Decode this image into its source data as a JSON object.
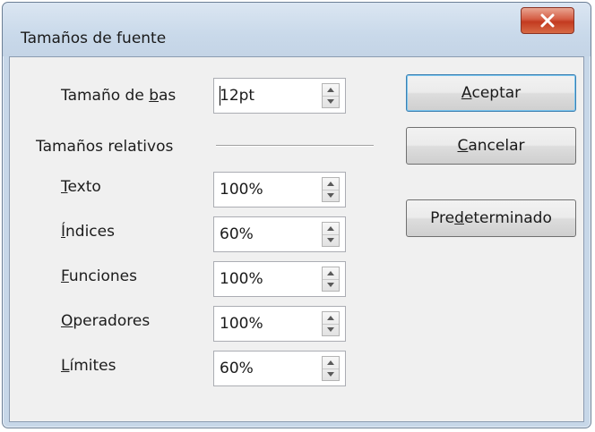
{
  "window": {
    "title": "Tamaños de fuente"
  },
  "base_size": {
    "label_pre": "Tamaño de ",
    "label_mnemonic": "b",
    "label_post": "as",
    "value": "12pt"
  },
  "relative": {
    "heading": "Tamaños relativos",
    "rows": [
      {
        "mnemonic": "T",
        "rest": "exto",
        "value": "100%"
      },
      {
        "mnemonic": "Í",
        "rest": "ndices",
        "value": "60%"
      },
      {
        "mnemonic": "F",
        "rest": "unciones",
        "value": "100%"
      },
      {
        "mnemonic": "O",
        "rest": "peradores",
        "value": "100%"
      },
      {
        "mnemonic": "L",
        "rest": "ímites",
        "value": "60%"
      }
    ]
  },
  "buttons": {
    "ok": {
      "mnemonic": "A",
      "rest": "ceptar"
    },
    "cancel": {
      "mnemonic": "C",
      "rest": "ancelar"
    },
    "default": {
      "pre": "Pre",
      "mnemonic": "d",
      "rest": "eterminado"
    }
  }
}
